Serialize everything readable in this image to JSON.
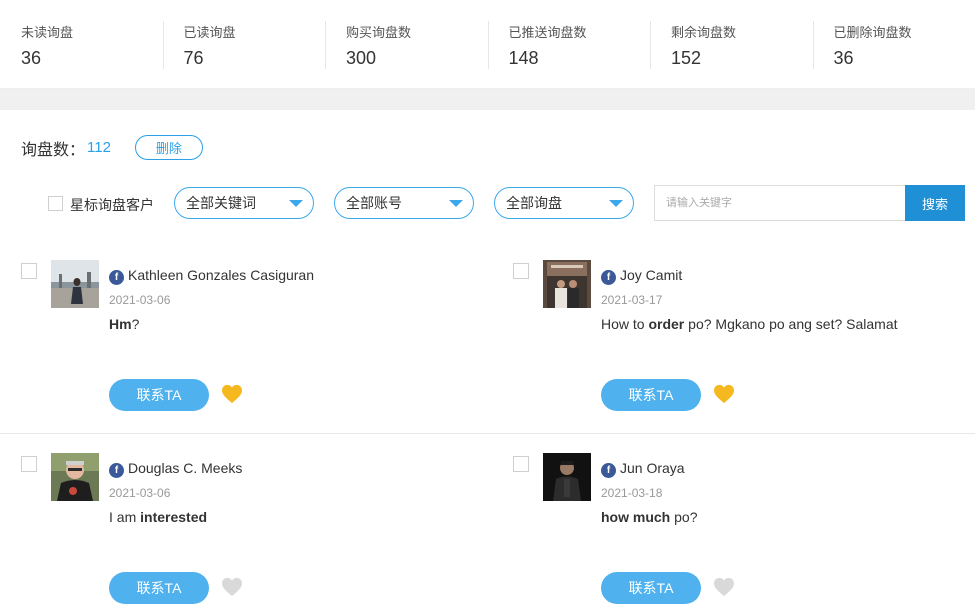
{
  "stats": [
    {
      "label": "未读询盘",
      "value": "36"
    },
    {
      "label": "已读询盘",
      "value": "76"
    },
    {
      "label": "购买询盘数",
      "value": "300"
    },
    {
      "label": "已推送询盘数",
      "value": "148"
    },
    {
      "label": "剩余询盘数",
      "value": "152"
    },
    {
      "label": "已删除询盘数",
      "value": "36"
    }
  ],
  "toolbar": {
    "count_label": "询盘数：",
    "count_value": "112",
    "delete_label": "删除",
    "star_label": "星标询盘客户",
    "keyword_select": "全部关键词",
    "account_select": "全部账号",
    "inquiry_select": "全部询盘",
    "search_placeholder": "请输入关键字",
    "search_label": "搜索"
  },
  "colors": {
    "accent": "#2aa0e6",
    "contact_button": "#4fb2ee",
    "heart_active": "#f5b91f",
    "heart_inactive": "#d9d9d9",
    "facebook": "#3b5998"
  },
  "cards": [
    {
      "name": "Kathleen Gonzales Casiguran",
      "date": "2021-03-06",
      "message_parts": [
        {
          "text": "Hm",
          "bold": true
        },
        {
          "text": "?",
          "bold": false
        }
      ],
      "contact_label": "联系TA",
      "favorited": true,
      "source_icon": "facebook-icon"
    },
    {
      "name": "Joy Camit",
      "date": "2021-03-17",
      "message_parts": [
        {
          "text": "How to ",
          "bold": false
        },
        {
          "text": "order",
          "bold": true
        },
        {
          "text": " po? Mgkano po ang set? Salamat",
          "bold": false
        }
      ],
      "contact_label": "联系TA",
      "favorited": true,
      "source_icon": "facebook-icon"
    },
    {
      "name": "Douglas C. Meeks",
      "date": "2021-03-06",
      "message_parts": [
        {
          "text": "I am ",
          "bold": false
        },
        {
          "text": "interested",
          "bold": true
        }
      ],
      "contact_label": "联系TA",
      "favorited": false,
      "source_icon": "facebook-icon"
    },
    {
      "name": "Jun Oraya",
      "date": "2021-03-18",
      "message_parts": [
        {
          "text": "how much",
          "bold": true
        },
        {
          "text": " po?",
          "bold": false
        }
      ],
      "contact_label": "联系TA",
      "favorited": false,
      "source_icon": "facebook-icon"
    }
  ]
}
